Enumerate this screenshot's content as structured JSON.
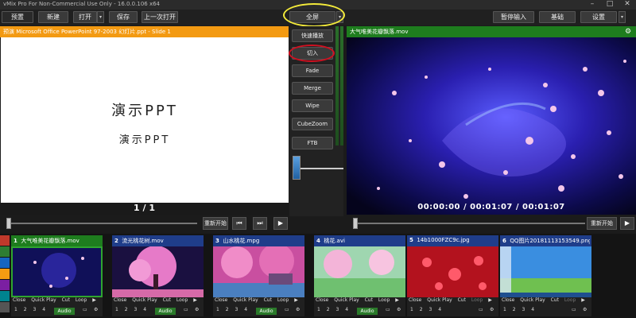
{
  "window": {
    "title": "vMix Pro For Non-Commercial Use Only - 16.0.0.106 x64",
    "controls": [
      "–",
      "□",
      "✕"
    ]
  },
  "toolbar": {
    "preview_label": "预置",
    "new_label": "新建",
    "open_label": "打开",
    "save_label": "保存",
    "last_open_label": "上一次打开",
    "fullscreen_label": "全屏",
    "pause_input_label": "暂停输入",
    "basic_label": "基础",
    "settings_label": "设置"
  },
  "preview": {
    "header": "预演 Microsoft Office PowerPoint 97-2003 幻灯片.ppt - Slide 1",
    "slide_title": "演示PPT",
    "slide_subtitle": "演示PPT",
    "page_counter": "1 / 1",
    "restart_label": "重新开始"
  },
  "transitions": {
    "quick_play_label": "快速播放",
    "cut_label": "切入",
    "items": [
      "Fade",
      "Merge",
      "Wipe",
      "CubeZoom"
    ],
    "ftb_label": "FTB"
  },
  "output": {
    "header": "大气唯美花瓣飘落.mov",
    "timecode": "00:00:00  /  00:01:07  /  00:01:07",
    "restart_label": "重新开始"
  },
  "inputs": [
    {
      "number": "1",
      "name": "大气唯美花瓣飘落.mov",
      "active": true,
      "audio_on": true
    },
    {
      "number": "2",
      "name": "流光桃花树.mov",
      "active": false,
      "audio_on": true
    },
    {
      "number": "3",
      "name": "山水桃花.mpg",
      "active": false,
      "audio_on": true
    },
    {
      "number": "4",
      "name": "桃花.avi",
      "active": false,
      "audio_on": true
    },
    {
      "number": "5",
      "name": "14b1000FZC9c.jpg",
      "active": false,
      "audio_on": false
    },
    {
      "number": "6",
      "name": "QQ图片20181113153549.png",
      "active": false,
      "audio_on": false
    }
  ],
  "tile_controls": {
    "close": "Close",
    "quick_play": "Quick Play",
    "cut": "Cut",
    "loop": "Loop",
    "audio": "Audio",
    "overlays": [
      "1",
      "2",
      "3",
      "4"
    ]
  },
  "colors": {
    "preview_header": "#f39a12",
    "output_header": "#1e7d1e",
    "input_header": "#1f3d8a",
    "highlight_yellow": "#f3ea3a",
    "highlight_red": "#d01020"
  },
  "color_tags": [
    "#c0392b",
    "#2e7d32",
    "#1565c0",
    "#f39c12",
    "#7b1fa2",
    "#00838f",
    "#555555"
  ]
}
